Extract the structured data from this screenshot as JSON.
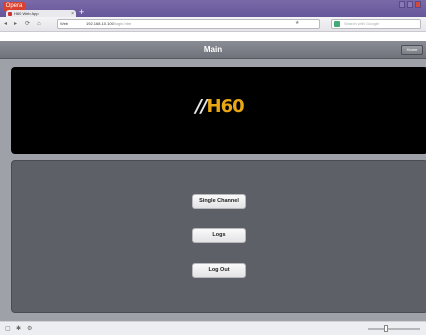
{
  "browser": {
    "menu_label": "Opera",
    "tab_title": "H60 Web App",
    "tab_close": "×",
    "new_tab": "+",
    "nav": {
      "back": "◂",
      "forward": "▸",
      "reload": "⟳",
      "home": "⌂"
    },
    "url_chip": "Web",
    "url_host": "192.168.10.100",
    "url_path": "/login.htm",
    "search_placeholder": "Search with Google"
  },
  "app": {
    "title": "Main",
    "home_label": "Home",
    "logo_stripe": "//",
    "logo_num": "H60"
  },
  "menu": {
    "buttons": [
      {
        "label": "Single Channel"
      },
      {
        "label": "Logs"
      },
      {
        "label": "Log Out"
      }
    ]
  },
  "status": {
    "icons": [
      "panel-icon",
      "speed-dial-icon",
      "settings-icon"
    ]
  },
  "colors": {
    "header": "#7c7f87",
    "content_bg": "#9ea1a8",
    "menu_panel": "#5e6068",
    "logo_accent": "#e8a714"
  }
}
